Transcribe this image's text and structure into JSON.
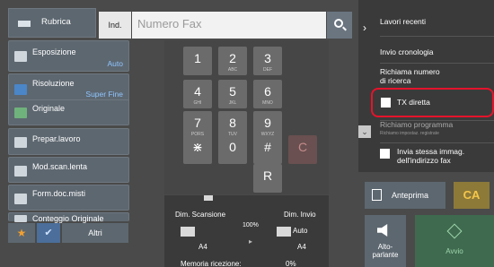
{
  "topbar": {
    "rubrica": "Rubrica",
    "ind": "Ind.",
    "fax_placeholder": "Numero Fax"
  },
  "left_menu": [
    {
      "label": "Esposizione",
      "value": "Auto"
    },
    {
      "label": "Risoluzione",
      "value": "Super Fine"
    },
    {
      "label": "Originale",
      "value": ""
    },
    {
      "label": "Prepar.lavoro",
      "value": ""
    },
    {
      "label": "Mod.scan.lenta",
      "value": ""
    },
    {
      "label": "Form.doc.misti",
      "value": ""
    },
    {
      "label": "Conteggio Originale",
      "value": ""
    }
  ],
  "bottom_left": {
    "altri": "Altri"
  },
  "keypad": [
    {
      "n": "1",
      "s": ""
    },
    {
      "n": "2",
      "s": "ABC"
    },
    {
      "n": "3",
      "s": "DEF"
    },
    {
      "n": "4",
      "s": "GHI"
    },
    {
      "n": "5",
      "s": "JKL"
    },
    {
      "n": "6",
      "s": "MNO"
    },
    {
      "n": "7",
      "s": "PQRS"
    },
    {
      "n": "8",
      "s": "TUV"
    },
    {
      "n": "9",
      "s": "WXYZ"
    },
    {
      "n": "⋇",
      "s": ""
    },
    {
      "n": "0",
      "s": ""
    },
    {
      "n": "#",
      "s": ""
    },
    {
      "n": "C",
      "s": ""
    },
    {
      "n": "R",
      "s": ""
    }
  ],
  "status": {
    "dim_scansione": "Dim. Scansione",
    "dim_invio": "Dim. Invio",
    "ratio": "100%",
    "auto": "Auto",
    "a4_left": "A4",
    "a4_right": "A4",
    "memoria": "Memoria ricezione:",
    "memoria_val": "0%"
  },
  "right_panel": {
    "lavori_recenti": "Lavori recenti",
    "invio_cronologia": "Invio cronologia",
    "richiama_numero": "Richiama numero",
    "di_ricerca": "di ricerca",
    "tx_diretta": "TX diretta",
    "richiamo_programma": "Richiamo programma",
    "richiamo_sub": "Richiamo impostaz. registrate",
    "invia_stessa": "Invia stessa immag.",
    "dell_indirizzo": "dell'indirizzo fax"
  },
  "actions": {
    "anteprima": "Anteprima",
    "ca": "CA",
    "alto": "Alto-",
    "parlante": "parlante",
    "avvio": "Avvio"
  },
  "colors": {
    "highlight": "#e5132b",
    "accent_value": "#8fc5ff"
  }
}
